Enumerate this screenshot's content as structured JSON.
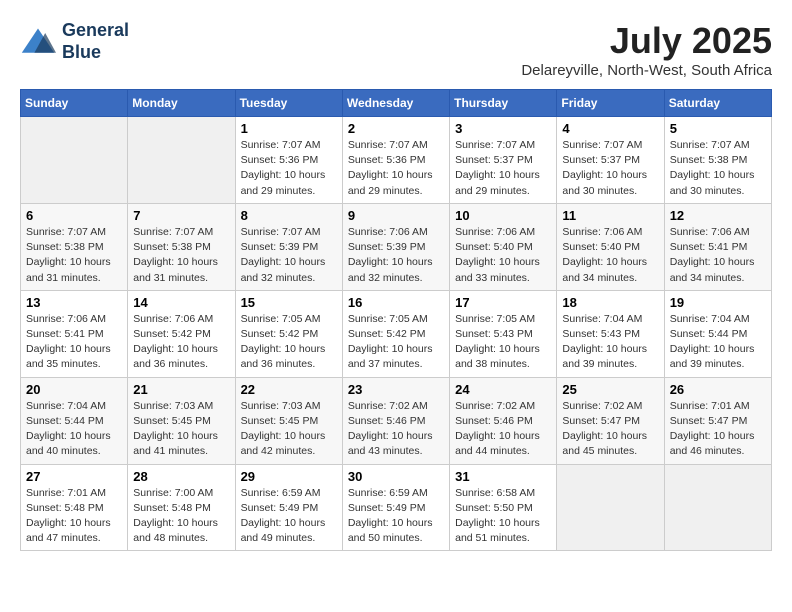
{
  "logo": {
    "line1": "General",
    "line2": "Blue"
  },
  "title": "July 2025",
  "location": "Delareyville, North-West, South Africa",
  "days_header": [
    "Sunday",
    "Monday",
    "Tuesday",
    "Wednesday",
    "Thursday",
    "Friday",
    "Saturday"
  ],
  "weeks": [
    [
      {
        "day": "",
        "info": ""
      },
      {
        "day": "",
        "info": ""
      },
      {
        "day": "1",
        "info": "Sunrise: 7:07 AM\nSunset: 5:36 PM\nDaylight: 10 hours\nand 29 minutes."
      },
      {
        "day": "2",
        "info": "Sunrise: 7:07 AM\nSunset: 5:36 PM\nDaylight: 10 hours\nand 29 minutes."
      },
      {
        "day": "3",
        "info": "Sunrise: 7:07 AM\nSunset: 5:37 PM\nDaylight: 10 hours\nand 29 minutes."
      },
      {
        "day": "4",
        "info": "Sunrise: 7:07 AM\nSunset: 5:37 PM\nDaylight: 10 hours\nand 30 minutes."
      },
      {
        "day": "5",
        "info": "Sunrise: 7:07 AM\nSunset: 5:38 PM\nDaylight: 10 hours\nand 30 minutes."
      }
    ],
    [
      {
        "day": "6",
        "info": "Sunrise: 7:07 AM\nSunset: 5:38 PM\nDaylight: 10 hours\nand 31 minutes."
      },
      {
        "day": "7",
        "info": "Sunrise: 7:07 AM\nSunset: 5:38 PM\nDaylight: 10 hours\nand 31 minutes."
      },
      {
        "day": "8",
        "info": "Sunrise: 7:07 AM\nSunset: 5:39 PM\nDaylight: 10 hours\nand 32 minutes."
      },
      {
        "day": "9",
        "info": "Sunrise: 7:06 AM\nSunset: 5:39 PM\nDaylight: 10 hours\nand 32 minutes."
      },
      {
        "day": "10",
        "info": "Sunrise: 7:06 AM\nSunset: 5:40 PM\nDaylight: 10 hours\nand 33 minutes."
      },
      {
        "day": "11",
        "info": "Sunrise: 7:06 AM\nSunset: 5:40 PM\nDaylight: 10 hours\nand 34 minutes."
      },
      {
        "day": "12",
        "info": "Sunrise: 7:06 AM\nSunset: 5:41 PM\nDaylight: 10 hours\nand 34 minutes."
      }
    ],
    [
      {
        "day": "13",
        "info": "Sunrise: 7:06 AM\nSunset: 5:41 PM\nDaylight: 10 hours\nand 35 minutes."
      },
      {
        "day": "14",
        "info": "Sunrise: 7:06 AM\nSunset: 5:42 PM\nDaylight: 10 hours\nand 36 minutes."
      },
      {
        "day": "15",
        "info": "Sunrise: 7:05 AM\nSunset: 5:42 PM\nDaylight: 10 hours\nand 36 minutes."
      },
      {
        "day": "16",
        "info": "Sunrise: 7:05 AM\nSunset: 5:42 PM\nDaylight: 10 hours\nand 37 minutes."
      },
      {
        "day": "17",
        "info": "Sunrise: 7:05 AM\nSunset: 5:43 PM\nDaylight: 10 hours\nand 38 minutes."
      },
      {
        "day": "18",
        "info": "Sunrise: 7:04 AM\nSunset: 5:43 PM\nDaylight: 10 hours\nand 39 minutes."
      },
      {
        "day": "19",
        "info": "Sunrise: 7:04 AM\nSunset: 5:44 PM\nDaylight: 10 hours\nand 39 minutes."
      }
    ],
    [
      {
        "day": "20",
        "info": "Sunrise: 7:04 AM\nSunset: 5:44 PM\nDaylight: 10 hours\nand 40 minutes."
      },
      {
        "day": "21",
        "info": "Sunrise: 7:03 AM\nSunset: 5:45 PM\nDaylight: 10 hours\nand 41 minutes."
      },
      {
        "day": "22",
        "info": "Sunrise: 7:03 AM\nSunset: 5:45 PM\nDaylight: 10 hours\nand 42 minutes."
      },
      {
        "day": "23",
        "info": "Sunrise: 7:02 AM\nSunset: 5:46 PM\nDaylight: 10 hours\nand 43 minutes."
      },
      {
        "day": "24",
        "info": "Sunrise: 7:02 AM\nSunset: 5:46 PM\nDaylight: 10 hours\nand 44 minutes."
      },
      {
        "day": "25",
        "info": "Sunrise: 7:02 AM\nSunset: 5:47 PM\nDaylight: 10 hours\nand 45 minutes."
      },
      {
        "day": "26",
        "info": "Sunrise: 7:01 AM\nSunset: 5:47 PM\nDaylight: 10 hours\nand 46 minutes."
      }
    ],
    [
      {
        "day": "27",
        "info": "Sunrise: 7:01 AM\nSunset: 5:48 PM\nDaylight: 10 hours\nand 47 minutes."
      },
      {
        "day": "28",
        "info": "Sunrise: 7:00 AM\nSunset: 5:48 PM\nDaylight: 10 hours\nand 48 minutes."
      },
      {
        "day": "29",
        "info": "Sunrise: 6:59 AM\nSunset: 5:49 PM\nDaylight: 10 hours\nand 49 minutes."
      },
      {
        "day": "30",
        "info": "Sunrise: 6:59 AM\nSunset: 5:49 PM\nDaylight: 10 hours\nand 50 minutes."
      },
      {
        "day": "31",
        "info": "Sunrise: 6:58 AM\nSunset: 5:50 PM\nDaylight: 10 hours\nand 51 minutes."
      },
      {
        "day": "",
        "info": ""
      },
      {
        "day": "",
        "info": ""
      }
    ]
  ]
}
